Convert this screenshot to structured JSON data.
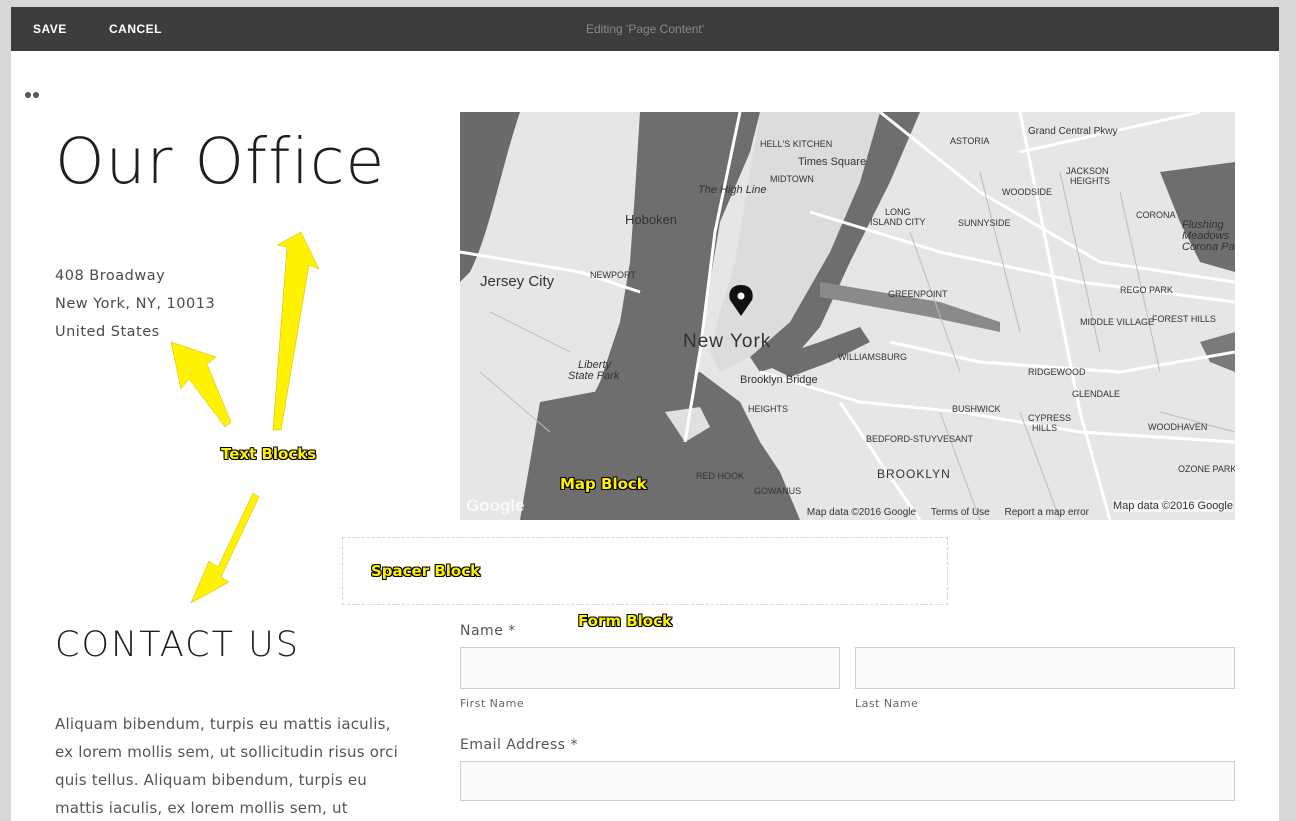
{
  "toolbar": {
    "save_label": "SAVE",
    "cancel_label": "CANCEL",
    "editing_title": "Editing 'Page Content'"
  },
  "page": {
    "office_title": "Our Office",
    "address_lines": [
      "408 Broadway",
      "New York, NY, 10013",
      "United States"
    ],
    "contact_title": "CONTACT US",
    "body_lines": [
      "Aliquam bibendum, turpis eu mattis iaculis,",
      "ex lorem mollis sem, ut sollicitudin risus orci",
      "quis tellus. Aliquam bibendum, turpis eu",
      "mattis iaculis, ex lorem mollis sem, ut"
    ]
  },
  "map": {
    "labels": {
      "new_york": "New York",
      "jersey_city": "Jersey City",
      "hoboken": "Hoboken",
      "brooklyn": "BROOKLYN",
      "brooklyn_bridge": "Brooklyn Bridge",
      "times_square": "Times Square",
      "high_line": "The High Line",
      "liberty": "Liberty",
      "state_park": "State Park",
      "midtown": "MIDTOWN",
      "astoria": "ASTORIA",
      "woodside": "WOODSIDE",
      "sunnyside": "SUNNYSIDE",
      "greenpoint": "GREENPOINT",
      "williamsburg": "WILLIAMSBURG",
      "bushwick": "BUSHWICK",
      "ridgewood": "RIDGEWOOD",
      "glendale": "GLENDALE",
      "middle_village": "MIDDLE VILLAGE",
      "rego_park": "REGO PARK",
      "forest_hills": "FOREST HILLS",
      "corona": "CORONA",
      "jackson_heights": "JACKSON",
      "jackson_heights_2": "HEIGHTS",
      "bed_stuy": "BEDFORD-STUYVESANT",
      "ozone_park": "OZONE PARK",
      "woodhaven": "WOODHAVEN",
      "red_hook": "RED HOOK",
      "gowanus": "GOWANUS",
      "park_slope": "HEIGHTS",
      "long_island_city": "LONG",
      "long_island_city_2": "ISLAND CITY",
      "newport": "NEWPORT",
      "flushing": "Flushing",
      "flushing_2": "Meadows",
      "flushing_3": "Corona Par",
      "hells_kitchen": "HELL'S KITCHEN",
      "cypress": "CYPRESS",
      "cypress_2": "HILLS",
      "grand_central": "Grand Central Pkwy"
    },
    "google_logo": "Google",
    "attribution": "Map data ©2016 Google",
    "terms": "Terms of Use",
    "report": "Report a map error",
    "attribution_overlay": "Map data ©2016 Google"
  },
  "form": {
    "name_label": "Name *",
    "first_name_label": "First Name",
    "last_name_label": "Last Name",
    "email_label": "Email Address *",
    "first_name_value": "",
    "last_name_value": "",
    "email_value": ""
  },
  "annotations": {
    "text_blocks": "Text Blocks",
    "map_block": "Map Block",
    "spacer_block": "Spacer Block",
    "form_block": "Form Block",
    "color": "#fff200"
  }
}
